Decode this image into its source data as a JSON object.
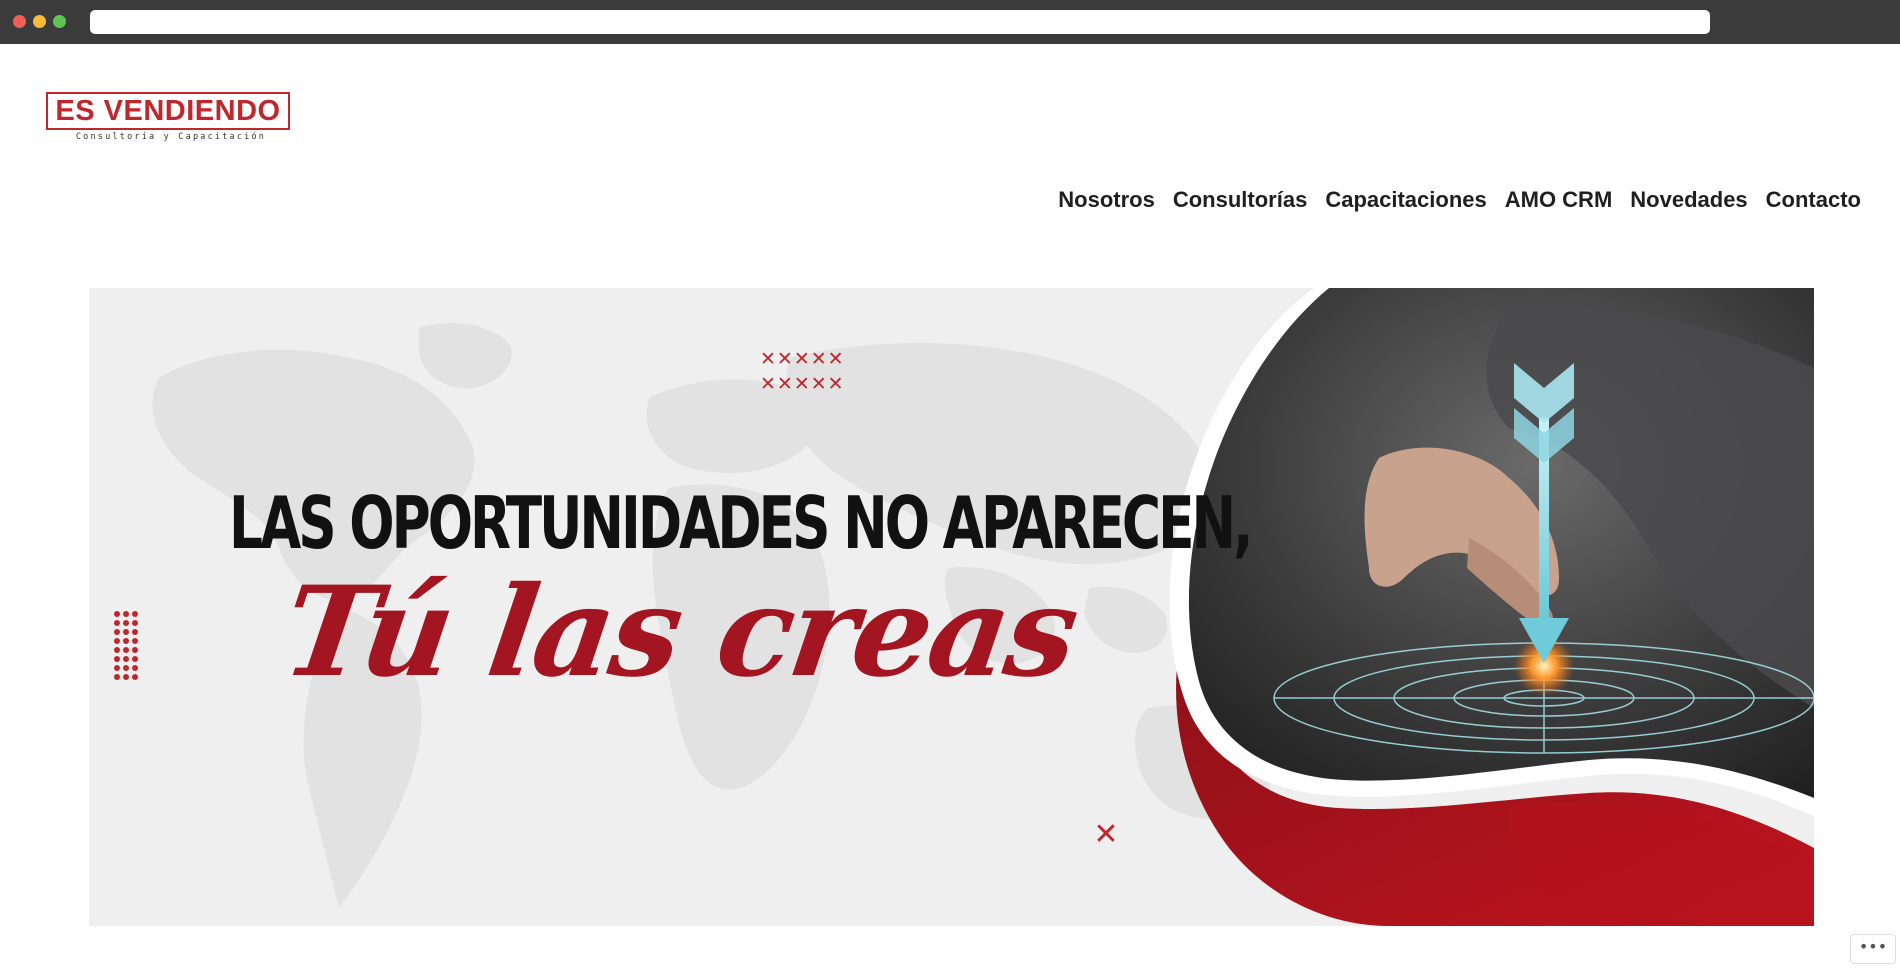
{
  "logo": {
    "title": "ES VENDIENDO",
    "subtitle": "Consultoría y Capacitación"
  },
  "nav": {
    "items": [
      "Nosotros",
      "Consultorías",
      "Capacitaciones",
      "AMO CRM",
      "Novedades",
      "Contacto"
    ]
  },
  "hero": {
    "headline": "LAS OPORTUNIDADES NO APARECEN,",
    "script": "Tú las creas",
    "x_pattern_row": "✕✕✕✕✕"
  },
  "icons": {
    "close": "close-icon",
    "more": "more-dots-icon"
  },
  "colors": {
    "brand_red": "#c0272d",
    "dark_red": "#a31621",
    "chrome": "#3b3b3b"
  }
}
